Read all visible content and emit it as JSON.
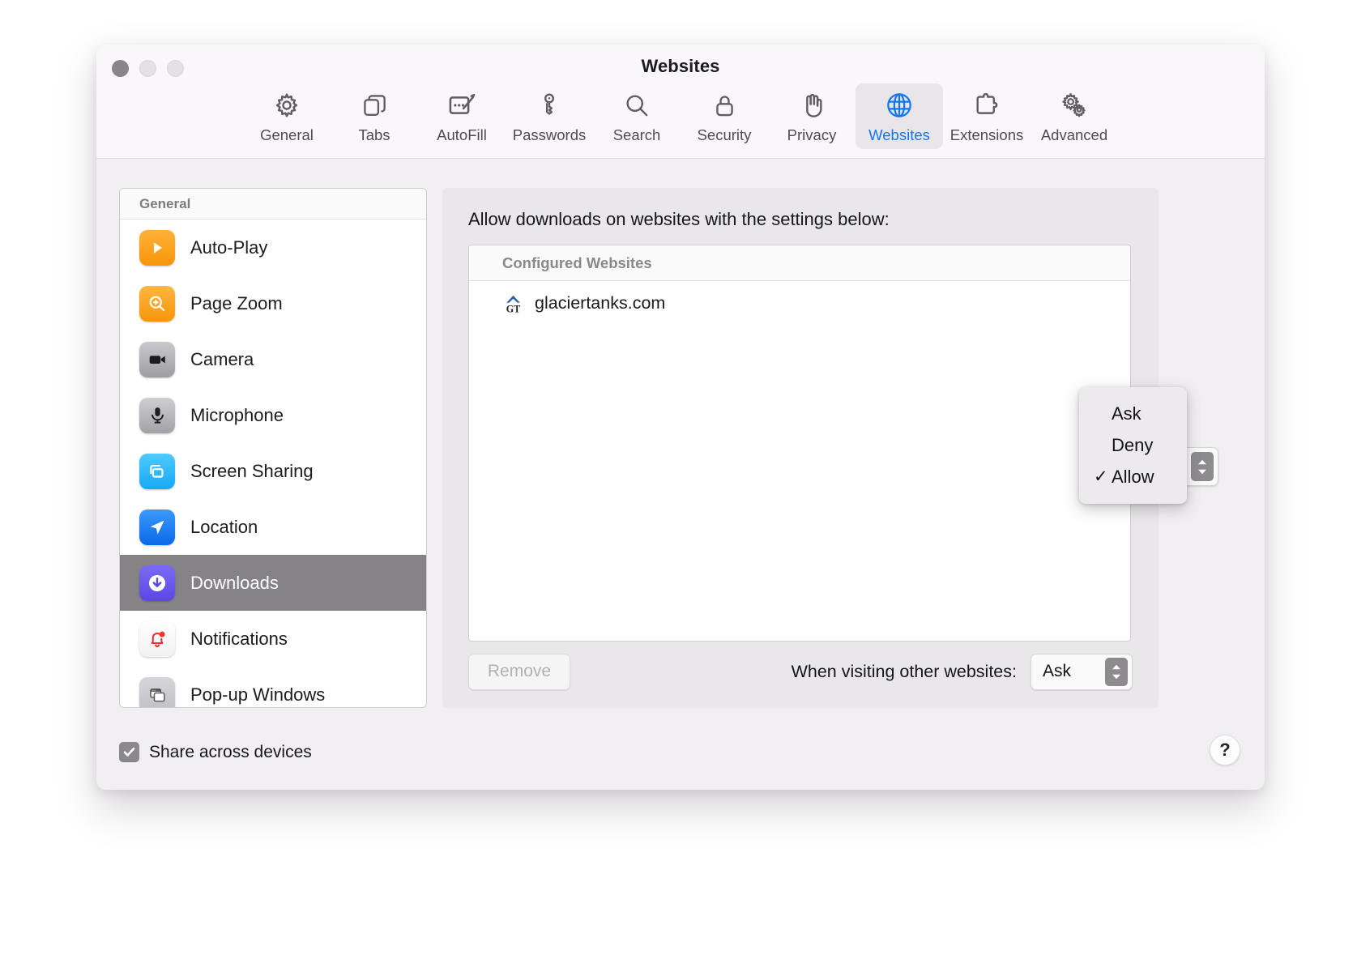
{
  "window": {
    "title": "Websites",
    "traffic_lights": [
      "close-button",
      "minimize-button",
      "zoom-button"
    ]
  },
  "toolbar": {
    "items": [
      {
        "label": "General",
        "icon": "gear-icon",
        "active": false
      },
      {
        "label": "Tabs",
        "icon": "tabs-icon",
        "active": false
      },
      {
        "label": "AutoFill",
        "icon": "autofill-icon",
        "active": false
      },
      {
        "label": "Passwords",
        "icon": "key-icon",
        "active": false
      },
      {
        "label": "Search",
        "icon": "magnifier-icon",
        "active": false
      },
      {
        "label": "Security",
        "icon": "lock-icon",
        "active": false
      },
      {
        "label": "Privacy",
        "icon": "hand-icon",
        "active": false
      },
      {
        "label": "Websites",
        "icon": "globe-icon",
        "active": true
      },
      {
        "label": "Extensions",
        "icon": "puzzle-icon",
        "active": false
      },
      {
        "label": "Advanced",
        "icon": "gears-icon",
        "active": false
      }
    ],
    "active_accent": "#1277f0"
  },
  "sidebar": {
    "header": "General",
    "items": [
      {
        "label": "Auto-Play",
        "icon": "play-icon",
        "selected": false
      },
      {
        "label": "Page Zoom",
        "icon": "page-zoom-icon",
        "selected": false
      },
      {
        "label": "Camera",
        "icon": "camera-icon",
        "selected": false
      },
      {
        "label": "Microphone",
        "icon": "microphone-icon",
        "selected": false
      },
      {
        "label": "Screen Sharing",
        "icon": "screen-sharing-icon",
        "selected": false
      },
      {
        "label": "Location",
        "icon": "location-icon",
        "selected": false
      },
      {
        "label": "Downloads",
        "icon": "downloads-icon",
        "selected": true
      },
      {
        "label": "Notifications",
        "icon": "bell-icon",
        "selected": false
      },
      {
        "label": "Pop-up Windows",
        "icon": "popup-windows-icon",
        "selected": false
      }
    ],
    "selected_bg": "#858386"
  },
  "share": {
    "label": "Share across devices",
    "checked": true,
    "checkmark": "✓"
  },
  "help": {
    "label": "?"
  },
  "pane": {
    "title": "Allow downloads on websites with the settings below:",
    "list_header": "Configured Websites",
    "rows": [
      {
        "site": "glaciertanks.com",
        "favicon": "glaciertanks-favicon",
        "value": "Allow"
      }
    ],
    "remove_label": "Remove",
    "remove_enabled": false,
    "other_label": "When visiting other websites:",
    "other_value": "Ask"
  },
  "popup_menu": {
    "visible": true,
    "items": [
      {
        "label": "Ask",
        "checked": false
      },
      {
        "label": "Deny",
        "checked": false
      },
      {
        "label": "Allow",
        "checked": true
      }
    ],
    "checkmark": "✓"
  }
}
